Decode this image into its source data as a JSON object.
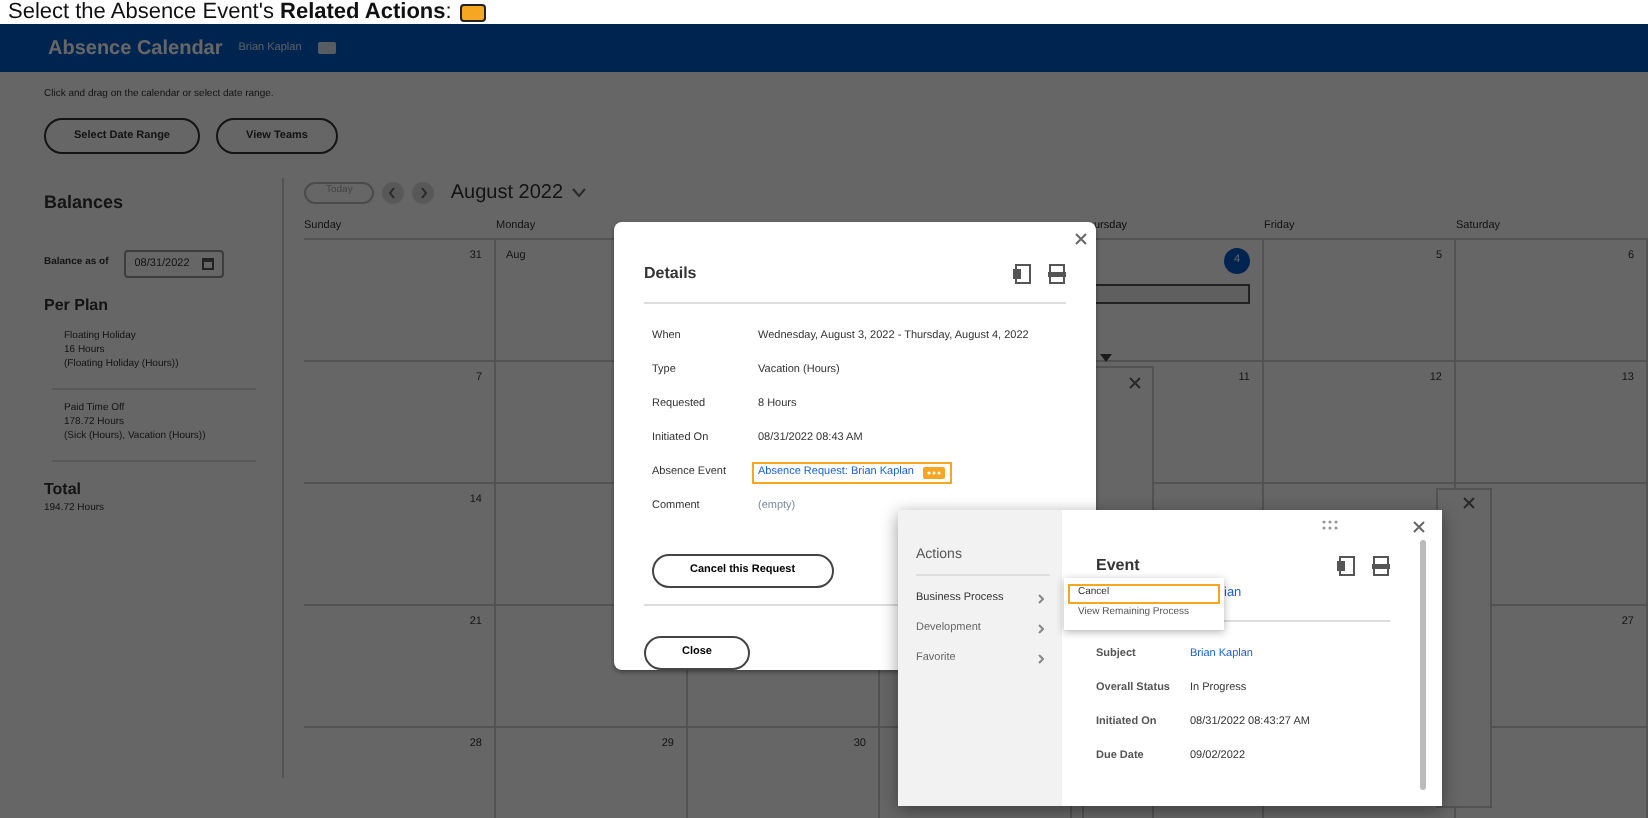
{
  "caption": {
    "text": "Select the Absence Event's **Related Actions**:"
  },
  "header": {
    "title": "Absence Calendar",
    "user": "Brian Kaplan"
  },
  "instructions": "Click and drag on the calendar or select date range.",
  "top_buttons": [
    "Select Date Range",
    "View Teams"
  ],
  "balances": {
    "title": "Balances",
    "as_of_label": "Balance as of",
    "as_of_value": "08/31/2022",
    "per_plan_title": "Per Plan",
    "plans": [
      {
        "lines": [
          "Floating Holiday",
          "16 Hours",
          "(Floating Holiday (Hours))"
        ]
      },
      {
        "lines": [
          "Paid Time Off",
          "178.72 Hours",
          "(Sick (Hours), Vacation (Hours))"
        ]
      }
    ],
    "total_title": "Total",
    "total_value": "194.72 Hours"
  },
  "calendar": {
    "today_button": {
      "label": "Today",
      "disabled": true
    },
    "month": "August 2022",
    "weekdays": {
      "sunday": "Sunday",
      "monday": "Monday",
      "thursday": "ursday",
      "friday": "Friday",
      "saturday": "Saturday"
    },
    "weeks": [
      {
        "sunday": {
          "day": "31",
          "current": false,
          "entry": false
        },
        "monday": {
          "day": "Aug",
          "current": false,
          "entry": false
        },
        "thursday": {
          "day": "4",
          "current": true,
          "entry": true
        },
        "friday": {
          "day": "5",
          "current": false,
          "entry": false
        },
        "saturday": {
          "day": "6",
          "current": false,
          "entry": false
        }
      },
      {
        "sunday": {
          "day": "7",
          "current": false,
          "entry": false
        },
        "thursday": {
          "day": "11",
          "current": false,
          "entry": false
        },
        "friday": {
          "day": "12",
          "current": false,
          "entry": false
        },
        "saturday": {
          "day": "13",
          "current": false,
          "entry": false
        }
      },
      {
        "sunday": {
          "day": "14",
          "current": false,
          "entry": false
        }
      },
      {
        "sunday": {
          "day": "21",
          "current": false,
          "entry": false
        },
        "saturday": {
          "day": "27",
          "current": false,
          "entry": false
        }
      },
      {
        "sunday": {
          "day": "28",
          "current": false,
          "entry": false
        },
        "monday": {
          "day": "29",
          "current": false,
          "entry": false
        },
        "tuesday": {
          "day": "30",
          "current": false,
          "entry": false
        }
      }
    ]
  },
  "details": {
    "title": "Details",
    "fields": [
      {
        "label": "When",
        "value": "Wednesday, August 3, 2022 - Thursday, August 4, 2022",
        "kind": "text",
        "highlighted": false
      },
      {
        "label": "Type",
        "value": "Vacation (Hours)",
        "kind": "text",
        "highlighted": false
      },
      {
        "label": "Requested",
        "value": "8 Hours",
        "kind": "text",
        "highlighted": false
      },
      {
        "label": "Initiated On",
        "value": "08/31/2022 08:43 AM",
        "kind": "text",
        "highlighted": false
      },
      {
        "label": "Absence Event",
        "value": "Absence Request: Brian Kaplan",
        "kind": "link",
        "highlighted": true
      },
      {
        "label": "Comment",
        "value": "(empty)",
        "kind": "muted",
        "highlighted": false
      }
    ],
    "cancel_button": "Cancel this Request",
    "close_button": "Close"
  },
  "related_actions": {
    "title": "Actions",
    "items": [
      {
        "label": "Business Process",
        "selected": true
      },
      {
        "label": "Development",
        "selected": false
      },
      {
        "label": "Favorite",
        "selected": false
      }
    ],
    "submenu": [
      {
        "label": "Cancel",
        "highlighted": true
      },
      {
        "label": "View Remaining Process",
        "highlighted": false
      }
    ],
    "event": {
      "title": "Event",
      "partial_link": "ian",
      "fields": [
        {
          "label": "Subject",
          "value": "Brian Kaplan",
          "kind": "link"
        },
        {
          "label": "Overall Status",
          "value": "In Progress",
          "kind": "text"
        },
        {
          "label": "Initiated On",
          "value": "08/31/2022 08:43:27 AM",
          "kind": "text"
        },
        {
          "label": "Due Date",
          "value": "09/02/2022",
          "kind": "text"
        }
      ]
    }
  }
}
